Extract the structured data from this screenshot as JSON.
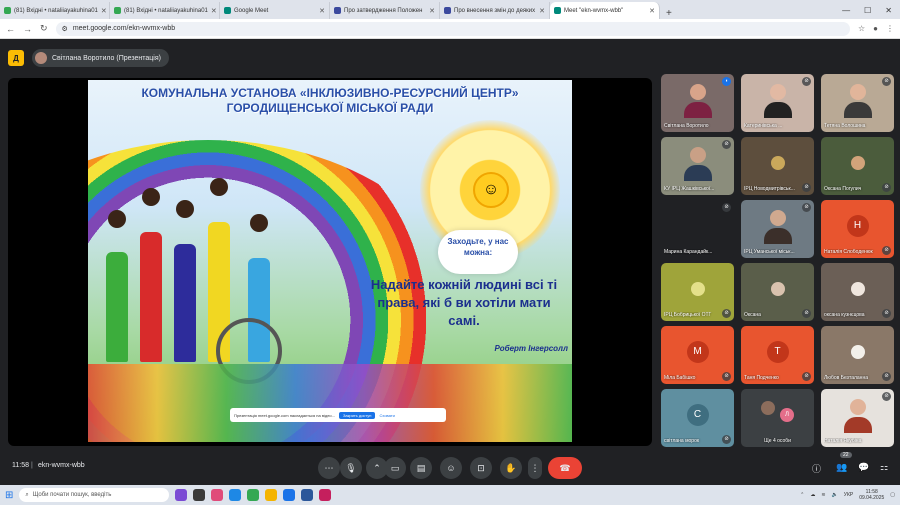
{
  "browser": {
    "tabs": [
      {
        "label": "(81) Вхідні • nataliiayakuhina01",
        "active": false,
        "color": "#34a853"
      },
      {
        "label": "(81) Вхідні • nataliiayakuhina01",
        "active": false,
        "color": "#34a853"
      },
      {
        "label": "Google Meet",
        "active": false,
        "color": "#00897b"
      },
      {
        "label": "Про затвердження Положен",
        "active": false,
        "color": "#3c4a9e"
      },
      {
        "label": "Про внесення змін до деяких",
        "active": false,
        "color": "#3c4a9e"
      },
      {
        "label": "Meet \"ekn-wvmx-wbb\"",
        "active": true,
        "color": "#00897b"
      }
    ],
    "new_tab": "+",
    "url": "meet.google.com/ekn-wvmx-wbb"
  },
  "meet": {
    "app_logo_letter": "Д",
    "presenter": "Світлана Воротило (Презентація)",
    "slide": {
      "title_line1": "КОМУНАЛЬНА УСТАНОВА «ІНКЛЮЗИВНО-РЕСУРСНИЙ ЦЕНТР»",
      "title_line2": "ГОРОДИЩЕНСЬКОЇ МІСЬКОЇ РАДИ",
      "cloud_text": "Заходьте, у нас можна:",
      "quote": "Надайте кожній людині всі ті права, які б ви хотіли мати самі.",
      "author": "Роберт Інгерсолл"
    },
    "share_bar": {
      "text": "Презентація meet.google.com накладається на відео...",
      "stop_label": "Закрить доступ",
      "hide_label": "Сховати"
    },
    "participants": [
      {
        "name": "Світлана Воротило",
        "kind": "video",
        "mic": "blue",
        "bg": "#7a6a68",
        "skin": "#d8a48a",
        "shirt": "#7d2142"
      },
      {
        "name": "Катеринівська ...",
        "kind": "video",
        "mic": "off",
        "bg": "#c9b4a8",
        "skin": "#e2b9a3",
        "shirt": "#222"
      },
      {
        "name": "Тетяна Волошина",
        "kind": "video",
        "mic": "off",
        "bg": "#b9a995",
        "skin": "#e1b59a",
        "shirt": "#3a3a3a"
      },
      {
        "name": "КУ ІРЦ Жашківської...",
        "kind": "video",
        "mic": "off",
        "bg": "#8b8d7c",
        "skin": "#c9a086",
        "shirt": "#2b3c55"
      },
      {
        "name": "ІРЦ Новодмитрівськ...",
        "kind": "avatar-img",
        "mic": "off",
        "bg": "#5d4e3d",
        "avatar": "#caa85b"
      },
      {
        "name": "Оксана Погулич",
        "kind": "avatar-img",
        "mic": "off",
        "bg": "#4b5c3c",
        "avatar": "#d2a37a"
      },
      {
        "name": "Марина Карандайк...",
        "kind": "blank",
        "mic": "off",
        "bg": "#202124"
      },
      {
        "name": "ІРЦ Уманської міськ...",
        "kind": "video",
        "mic": "off",
        "bg": "#6e7a83",
        "skin": "#d0a98f",
        "shirt": "#3b2f2a"
      },
      {
        "name": "Наталія Слободенюк",
        "kind": "letter",
        "mic": "off",
        "bg": "#e8552f",
        "letter": "Н"
      },
      {
        "name": "ІРЦ Бобрицької ОТГ",
        "kind": "avatar-img",
        "mic": "off",
        "bg": "#9fa43a",
        "avatar": "#e4e08a"
      },
      {
        "name": "Оксана",
        "kind": "avatar-img",
        "mic": "off",
        "bg": "#5a5e4a",
        "avatar": "#d9c2ae"
      },
      {
        "name": "оксана кузнєцова",
        "kind": "avatar-img",
        "mic": "off",
        "bg": "#6b5f56",
        "avatar": "#efe6de"
      },
      {
        "name": "Міла Бабішко",
        "kind": "letter",
        "mic": "off",
        "bg": "#e8552f",
        "letter": "М"
      },
      {
        "name": "Таня Подченко",
        "kind": "letter",
        "mic": "off",
        "bg": "#e8552f",
        "letter": "Т"
      },
      {
        "name": "Любов Безталанна",
        "kind": "avatar-img",
        "mic": "off",
        "bg": "#8a7868",
        "avatar": "#f3f0ea"
      },
      {
        "name": "світлана морок",
        "kind": "letter",
        "mic": "off",
        "bg": "#5f8fa0",
        "letter": "С"
      },
      {
        "name": "Ще 4 особи",
        "kind": "group",
        "mic": "none",
        "bg": "#3c4043",
        "letter": "Л"
      },
      {
        "name": "Наталія Якубіна",
        "kind": "video",
        "mic": "off",
        "bg": "#e6e2dd",
        "skin": "#e1b399",
        "shirt": "#a33a28"
      }
    ],
    "controls": {
      "clock": "11:58",
      "separator": "|",
      "meeting_code": "ekn-wvmx-wbb",
      "participant_count": "22"
    }
  },
  "taskbar": {
    "search_placeholder": "Щоби почати пошук, введіть",
    "lang": "УКР",
    "time": "11:58",
    "date": "09.04.2025"
  }
}
